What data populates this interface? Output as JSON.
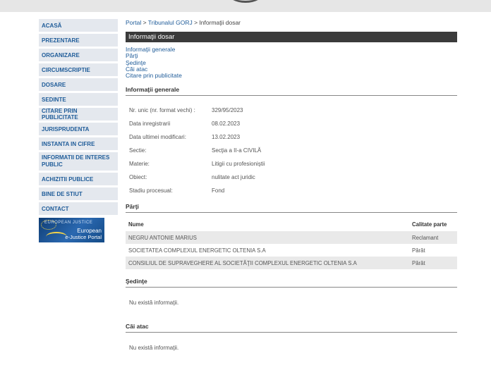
{
  "sidebar": {
    "items": [
      {
        "label": "ACASĂ",
        "name": "sidebar-item-acasa"
      },
      {
        "label": "PREZENTARE",
        "name": "sidebar-item-prezentare"
      },
      {
        "label": "ORGANIZARE",
        "name": "sidebar-item-organizare"
      },
      {
        "label": "CIRCUMSCRIPTIE",
        "name": "sidebar-item-circumscriptie"
      },
      {
        "label": "DOSARE",
        "name": "sidebar-item-dosare"
      },
      {
        "label": "SEDINTE",
        "name": "sidebar-item-sedinte"
      },
      {
        "label": "CITARE PRIN PUBLICITATE",
        "name": "sidebar-item-citare"
      },
      {
        "label": "JURISPRUDENTA",
        "name": "sidebar-item-jurisprudenta"
      },
      {
        "label": "INSTANTA IN CIFRE",
        "name": "sidebar-item-instanta-in-cifre"
      },
      {
        "label": "INFORMATII DE INTERES PUBLIC",
        "name": "sidebar-item-informatii-interes-public"
      },
      {
        "label": "ACHIZITII PUBLICE",
        "name": "sidebar-item-achizitii-publice"
      },
      {
        "label": "BINE DE STIUT",
        "name": "sidebar-item-bine-de-stiut"
      },
      {
        "label": "CONTACT",
        "name": "sidebar-item-contact"
      }
    ],
    "ejustice": {
      "top": "EUROPEAN JUSTICE",
      "line1": "European",
      "line2": "e-Justice Portal"
    }
  },
  "breadcrumb": {
    "portal": "Portal",
    "sep1": " > ",
    "court": "Tribunalul GORJ",
    "sep2": " > ",
    "current": "Informaţii dosar"
  },
  "title": "Informaţii dosar",
  "links": [
    "Informaţii generale",
    "Părţi",
    "Şedinţe",
    "Căi atac",
    "Citare prin publicitate"
  ],
  "general": {
    "heading": "Informaţii generale",
    "rows": [
      {
        "label": "Nr. unic (nr. format vechi) :",
        "value": "329/95/2023"
      },
      {
        "label": "Data inregistrarii",
        "value": "08.02.2023"
      },
      {
        "label": "Data ultimei modificari:",
        "value": "13.02.2023"
      },
      {
        "label": "Sectie:",
        "value": "Secţia a II-a CIVILĂ"
      },
      {
        "label": "Materie:",
        "value": "Litigii cu profesioniştii"
      },
      {
        "label": "Obiect:",
        "value": "nulitate act juridic"
      },
      {
        "label": "Stadiu procesual:",
        "value": "Fond"
      }
    ]
  },
  "parti": {
    "heading": "Părţi",
    "col_name": "Nume",
    "col_role": "Calitate parte",
    "rows": [
      {
        "name": "NEGRU ANTONIE MARIUS",
        "role": "Reclamant"
      },
      {
        "name": "SOCIETATEA COMPLEXUL ENERGETIC OLTENIA S.A",
        "role": "Pârât"
      },
      {
        "name": "CONSILIUL DE SUPRAVEGHERE AL SOCIETĂŢII COMPLEXUL ENERGETIC OLTENIA S.A",
        "role": "Pârât"
      }
    ]
  },
  "sedinte": {
    "heading": "Şedinţe",
    "empty": "Nu există informaţii."
  },
  "cai_atac": {
    "heading": "Căi atac",
    "empty": "Nu există informaţii."
  }
}
